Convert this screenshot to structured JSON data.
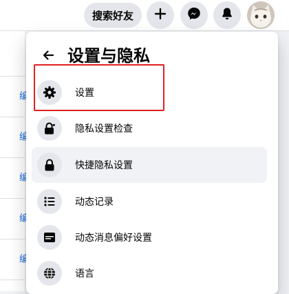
{
  "topbar": {
    "search_friends_label": "搜索好友"
  },
  "panel": {
    "title": "设置与隐私",
    "items": [
      {
        "label": "设置",
        "icon": "gear-icon"
      },
      {
        "label": "隐私设置检查",
        "icon": "lock-heart-icon"
      },
      {
        "label": "快捷隐私设置",
        "icon": "lock-icon"
      },
      {
        "label": "动态记录",
        "icon": "list-icon"
      },
      {
        "label": "动态消息偏好设置",
        "icon": "feed-icon"
      },
      {
        "label": "语言",
        "icon": "globe-icon"
      }
    ]
  },
  "background": {
    "link_text": "编"
  },
  "colors": {
    "accent_link": "#216fdb",
    "highlight_border": "#e02020",
    "button_bg": "#e4e6eb"
  }
}
